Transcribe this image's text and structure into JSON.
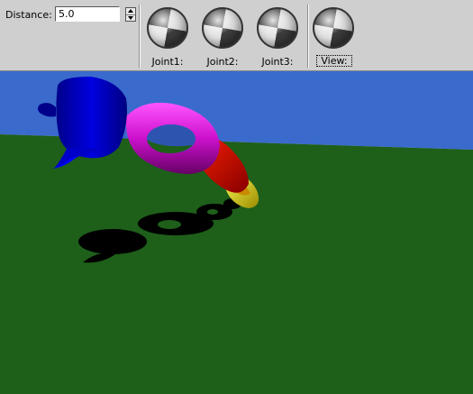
{
  "toolbar": {
    "distance_label": "Distance:",
    "distance_value": "5.0",
    "trackballs": [
      {
        "label": "Joint1:"
      },
      {
        "label": "Joint2:"
      },
      {
        "label": "Joint3:"
      },
      {
        "label": "View:"
      }
    ]
  },
  "scene": {
    "sky_color": "#3a6acc",
    "ground_color": "#1e5f1a",
    "teapot_color": "#0000d0",
    "torus_color": "#cc11cc",
    "link_color": "#cc1100",
    "end_color": "#e0d400"
  }
}
